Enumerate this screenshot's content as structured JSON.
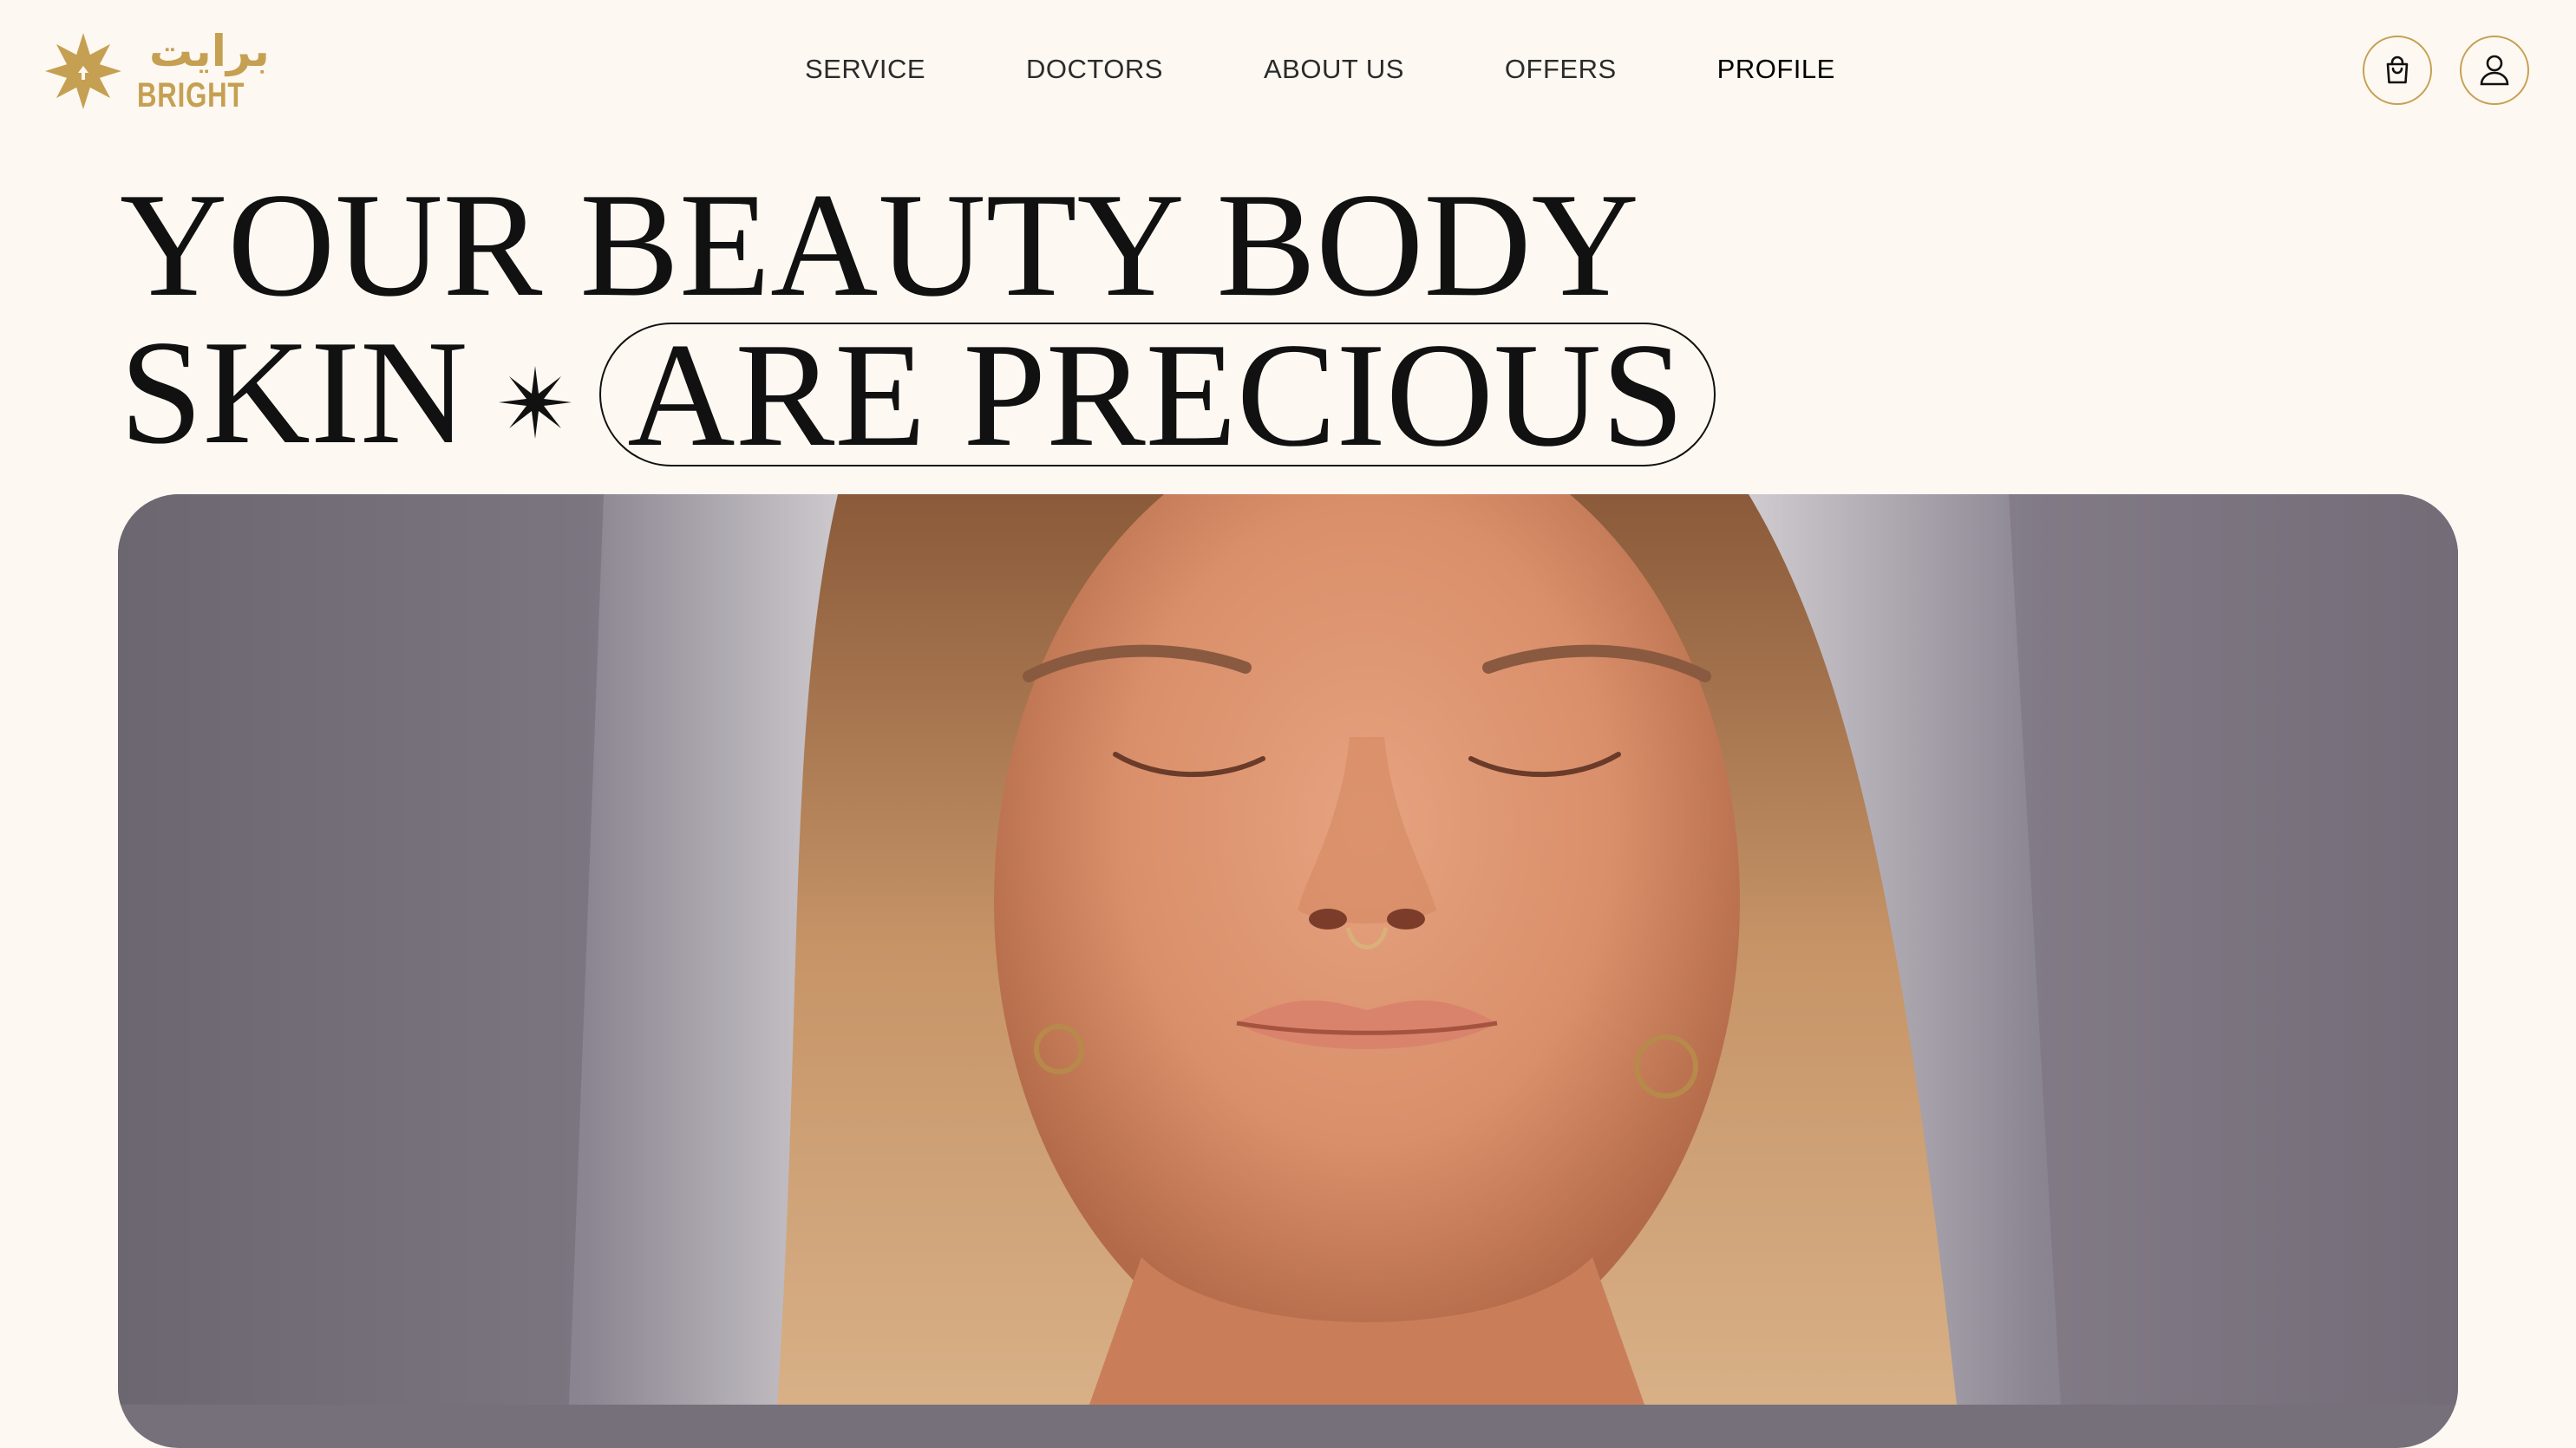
{
  "brand": {
    "name_arabic": "برايت",
    "name_latin": "BRIGHT",
    "logo_icon": "eight-point-star-icon",
    "color": "#c6a052"
  },
  "nav": {
    "items": [
      {
        "label": "SERVICE"
      },
      {
        "label": "DOCTORS"
      },
      {
        "label": "ABOUT US"
      },
      {
        "label": "OFFERS"
      },
      {
        "label": "PROFILE"
      }
    ]
  },
  "header_icons": {
    "cart": "shopping-bag-icon",
    "account": "user-icon"
  },
  "hero": {
    "line1": "YOUR BEAUTY BODY",
    "line2_start": "SKIN",
    "line2_separator_icon": "sparkle-star-icon",
    "line2_highlight": "ARE PRECIOUS",
    "image_subject": "portrait-photo"
  },
  "colors": {
    "background": "#fdf8f2",
    "accent": "#c6a052",
    "text": "#111111"
  }
}
